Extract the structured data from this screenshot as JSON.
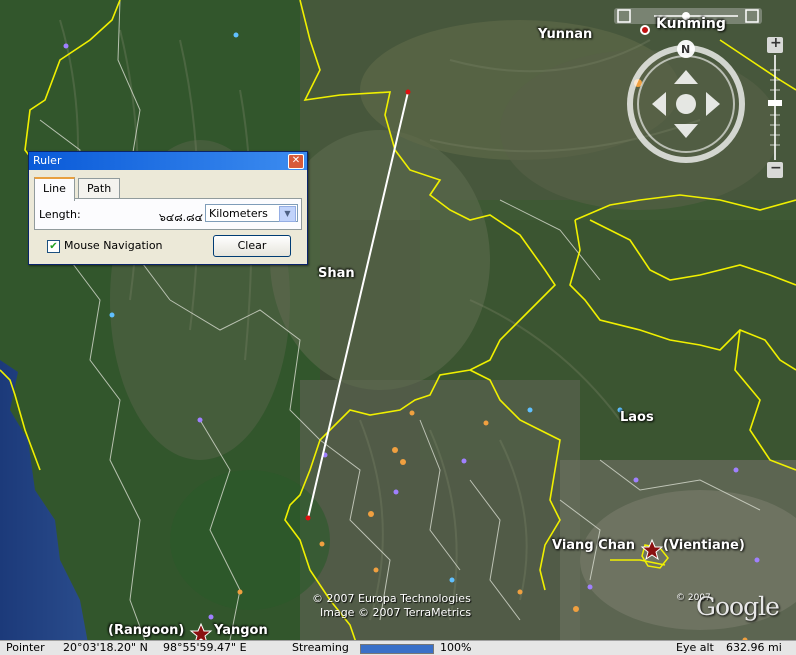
{
  "map": {
    "labels": {
      "kunming": "Kunming",
      "yunnan": "Yunnan",
      "shan": "Shan",
      "laos": "Laos",
      "vientiane": "Viang Chan",
      "vientiane_alt": "(Vientiane)",
      "rangoon": "(Rangoon)",
      "yangon": "Yangon"
    },
    "copyright_line1": "© 2007 Europa Technologies",
    "copyright_line2": "Image © 2007 TerraMetrics",
    "copyright_right": "© 2007",
    "logo": "Google",
    "compass_north": "N",
    "zoom_in": "+",
    "zoom_out": "−"
  },
  "ruler": {
    "title": "Ruler",
    "tabs": [
      "Line",
      "Path"
    ],
    "active_tab": "Line",
    "length_label": "Length:",
    "length_value": "๖๔๘.๘๔",
    "unit": "Kilometers",
    "mouse_nav_label": "Mouse Navigation",
    "mouse_nav_checked": true,
    "clear_label": "Clear"
  },
  "statusbar": {
    "pointer_label": "Pointer",
    "lat": "20°03'18.20\" N",
    "lon": "98°55'59.47\" E",
    "streaming_label": "Streaming",
    "streaming_percent": "100%",
    "streaming_fraction": 1.0,
    "eye_alt": "Eye alt",
    "eye_alt_value": "632.96 mi"
  },
  "colors": {
    "border_yellow": "#f0f000",
    "ruler_line": "#ffffff",
    "titlebar": "#0a5ad8"
  }
}
